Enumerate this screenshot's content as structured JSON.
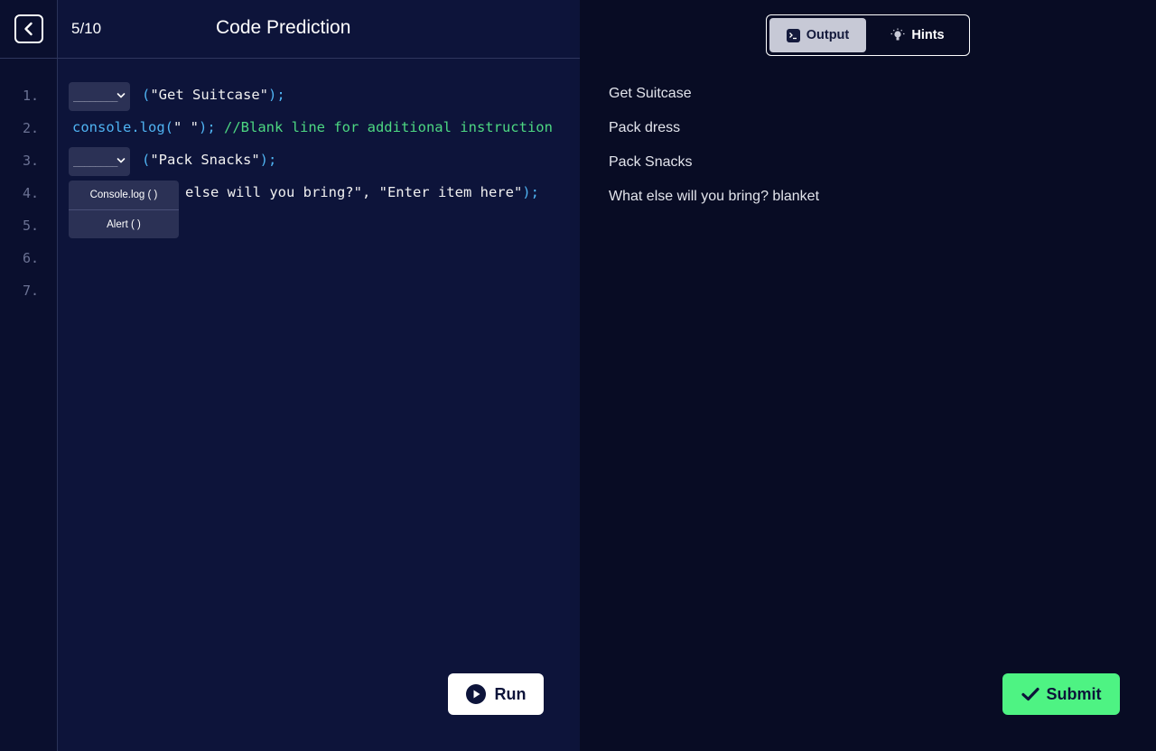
{
  "header": {
    "progress": "5/10",
    "title": "Code Prediction"
  },
  "editor": {
    "line_numbers": [
      "1.",
      "2.",
      "3.",
      "4.",
      "5.",
      "6.",
      "7."
    ],
    "dropdown_placeholder": "________",
    "line1": {
      "open": "(",
      "arg": "\"Get Suitcase\"",
      "close": ");"
    },
    "line2": {
      "fn": "console.log(",
      "arg": "\" \"",
      "close": ");",
      "comment": "//Blank line for additional instruction"
    },
    "line3": {
      "open": "(",
      "arg": "\"Pack Snacks\"",
      "close": ");"
    },
    "line4": {
      "args": "else will you bring?\", \"Enter item here\"",
      "close": ");"
    },
    "dropdown_options": [
      "Console.log ( )",
      "Alert ( )"
    ]
  },
  "run_button": {
    "label": "Run"
  },
  "tabs": {
    "output_label": "Output",
    "hints_label": "Hints",
    "active": "Output"
  },
  "output": [
    "Get Suitcase",
    "Pack dress",
    "Pack Snacks",
    "What else will you bring? blanket"
  ],
  "submit_button": {
    "label": "Submit"
  },
  "colors": {
    "keyword": "#4fb3f2",
    "comment": "#4dd882",
    "submit": "#4ef383",
    "editor_bg": "#0d143a",
    "page_bg": "#080c24"
  },
  "icons": {
    "back": "chevron-left-icon",
    "run": "play-circle-icon",
    "output_tab": "terminal-icon",
    "hints_tab": "lightbulb-icon",
    "submit": "checkmark-icon",
    "dropdown": "chevron-down-icon"
  }
}
